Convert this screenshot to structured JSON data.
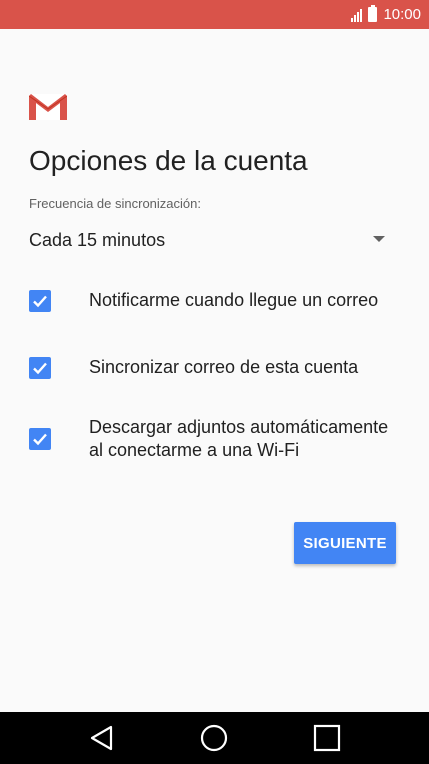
{
  "status_bar": {
    "time": "10:00",
    "color": "#d9534a",
    "icons": [
      "signal-icon",
      "battery-icon"
    ]
  },
  "app": {
    "logo": "gmail-logo-icon",
    "title": "Opciones de la cuenta"
  },
  "sync": {
    "label": "Frecuencia de sincronización:",
    "value": "Cada 15 minutos",
    "icon": "dropdown-arrow-icon"
  },
  "options": [
    {
      "label": "Notificarme cuando llegue un correo",
      "checked": true
    },
    {
      "label": "Sincronizar correo de esta cuenta",
      "checked": true
    },
    {
      "label": "Descargar adjuntos automáticamente al conectarme a una Wi-Fi",
      "checked": true
    }
  ],
  "next_button": {
    "label": "SIGUIENTE",
    "color": "#4285f4"
  },
  "nav_bar": {
    "icons": [
      "back-icon",
      "home-icon",
      "recents-icon"
    ]
  }
}
